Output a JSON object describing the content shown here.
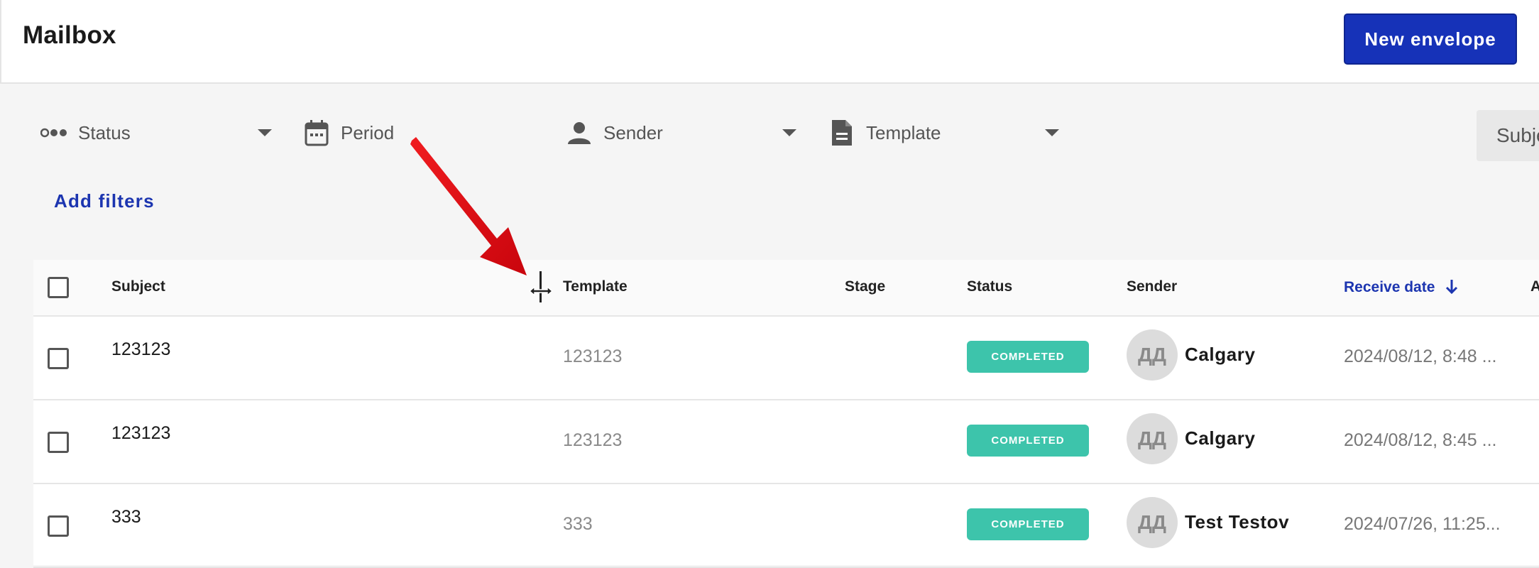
{
  "header": {
    "title": "Mailbox",
    "new_envelope_label": "New envelope"
  },
  "filters": {
    "status_label": "Status",
    "period_label": "Period",
    "sender_label": "Sender",
    "template_label": "Template",
    "subject_search_placeholder": "Subject",
    "add_filters_label": "Add filters"
  },
  "table": {
    "columns": {
      "subject": "Subject",
      "template": "Template",
      "stage": "Stage",
      "status": "Status",
      "sender": "Sender",
      "receive_date": "Receive date",
      "extra": "A"
    },
    "sort": {
      "column": "receive_date",
      "direction": "desc"
    },
    "rows": [
      {
        "subject": "123123",
        "template": "123123",
        "stage": "",
        "status": "COMPLETED",
        "avatar": "ДД",
        "sender": "Calgary",
        "receive_date": "2024/08/12, 8:48 ..."
      },
      {
        "subject": "123123",
        "template": "123123",
        "stage": "",
        "status": "COMPLETED",
        "avatar": "ДД",
        "sender": "Calgary",
        "receive_date": "2024/08/12, 8:45 ..."
      },
      {
        "subject": "333",
        "template": "333",
        "stage": "",
        "status": "COMPLETED",
        "avatar": "ДД",
        "sender": "Test Testov",
        "receive_date": "2024/07/26, 11:25..."
      }
    ]
  },
  "colors": {
    "primary": "#1632b8",
    "status_completed": "#3dc4ab",
    "annotation_arrow": "#e8141c"
  },
  "icons": {
    "status": "dots-icon",
    "period": "calendar-icon",
    "sender": "person-icon",
    "template": "document-icon",
    "sort": "arrow-down-icon",
    "cursor": "column-resize-cursor-icon"
  }
}
